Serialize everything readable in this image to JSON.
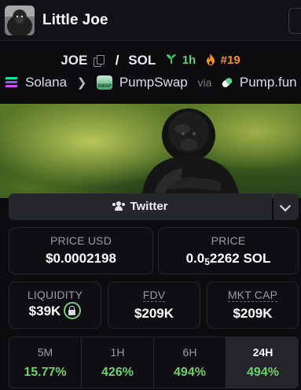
{
  "header": {
    "title": "Little Joe"
  },
  "pair": {
    "base": "JOE",
    "separator": "/",
    "quote": "SOL",
    "age": "1h",
    "rank": "#19"
  },
  "route": {
    "chain": "Solana",
    "dex": "PumpSwap",
    "via": "via",
    "launchpad": "Pump.fun",
    "dex_badge": "SWAP"
  },
  "social": {
    "twitter_label": "Twitter"
  },
  "prices": {
    "usd_label": "PRICE USD",
    "usd_value": "$0.0002198",
    "native_label": "PRICE",
    "native_prefix": "0.0",
    "native_zeros": "5",
    "native_digits": "2262 SOL"
  },
  "stats": {
    "liquidity_label": "LIQUIDITY",
    "liquidity_value": "$39K",
    "fdv_label": "FDV",
    "fdv_value": "$209K",
    "mktcap_label": "MKT CAP",
    "mktcap_value": "$209K"
  },
  "timeframes": [
    {
      "label": "5M",
      "change": "15.77%"
    },
    {
      "label": "1H",
      "change": "426%"
    },
    {
      "label": "6H",
      "change": "494%"
    },
    {
      "label": "24H",
      "change": "494%",
      "selected": true
    }
  ],
  "colors": {
    "positive": "#6fcf6f",
    "age": "#5dcf7e",
    "hot": "#f7931a",
    "lock_ring": "#7ec97e"
  },
  "icons": [
    "gorilla-avatar",
    "copy-icon",
    "sprout-icon",
    "fire-icon",
    "solana-icon",
    "chevron-right-icon",
    "pumpswap-icon",
    "pill-icon",
    "people-icon",
    "chevron-down-icon",
    "lock-icon"
  ]
}
